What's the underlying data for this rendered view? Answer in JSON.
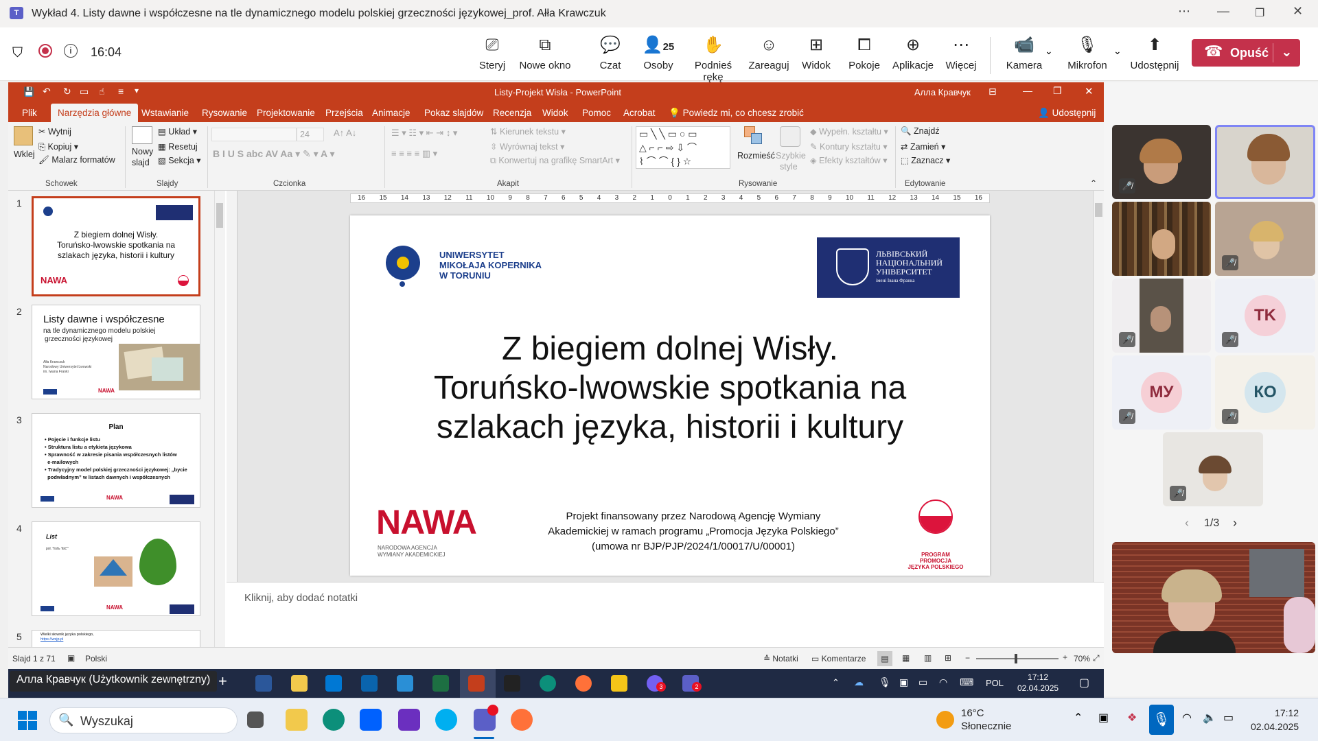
{
  "teams": {
    "window_title": "Wykład 4. Listy dawne i współczesne na tle dynamicznego modelu polskiej grzeczności językowej_prof. Ałła Krawczuk",
    "timer": "16:04",
    "toolbar": {
      "share_screen": "Sterуj",
      "new_window": "Nowe okno",
      "chat": "Czat",
      "people": "Osoby",
      "people_count": "25",
      "raise_hand": "Podnieś rękę",
      "react": "Zareaguj",
      "view": "Widok",
      "rooms": "Pokoje",
      "apps": "Aplikacje",
      "more": "Więcej",
      "camera": "Kamera",
      "mic": "Mikrofon",
      "share": "Udostępnij",
      "leave": "Opuść"
    },
    "participants": {
      "avatars": [
        "TK",
        "МУ",
        "КО"
      ],
      "pager": "1/3"
    },
    "presenter_name": "Алла Кравчук (Użytkownik zewnętrzny)"
  },
  "ppt": {
    "title": "Listy-Projekt Wisła  -  PowerPoint",
    "user": "Алла Кравчук",
    "tabs": [
      "Plik",
      "Narzędzia główne",
      "Wstawianie",
      "Rysowanie",
      "Projektowanie",
      "Przejścia",
      "Animacje",
      "Pokaz slajdów",
      "Recenzja",
      "Widok",
      "Pomoc",
      "Acrobat"
    ],
    "tell_me": "Powiedz mi, co chcesz zrobić",
    "share": "Udostępnij",
    "ribbon": {
      "paste": "Wklej",
      "cut": "Wytnij",
      "copy": "Kopiuj",
      "format_painter": "Malarz formatów",
      "clipboard": "Schowek",
      "new_slide_1": "Nowy",
      "new_slide_2": "slajd",
      "layout": "Układ",
      "reset": "Resetuj",
      "section": "Sekcja",
      "slides": "Slajdy",
      "font_size": "24",
      "font": "Czcionka",
      "text_direction": "Kierunek tekstu",
      "align_text": "Wyrównaj tekst",
      "smartart": "Konwertuj na grafikę SmartArt",
      "paragraph": "Akapit",
      "arrange": "Rozmieść",
      "quick_styles_1": "Szybkie",
      "quick_styles_2": "style",
      "fill": "Wypełn. kształtu",
      "outline": "Kontury kształtu",
      "effects": "Efekty kształtów",
      "drawing": "Rysowanie",
      "find": "Znajdź",
      "replace": "Zamień",
      "select": "Zaznacz",
      "editing": "Edytowanie"
    },
    "thumbs": [
      {
        "num": "1",
        "l1": "Z biegiem dolnej Wisły.",
        "l2": "Toruńsko-lwowskie spotkania na",
        "l3": "szlakach języka, historii i kultury"
      },
      {
        "num": "2",
        "title": "Listy dawne i współczesne",
        "sub1": "na tle dynamicznego modelu polskiej",
        "sub2": "grzeczności językowej",
        "a1": "Ałła Krawczuk",
        "a2": "Narodowy Uniwersytet Lwowski",
        "a3": "im. Iwana Franki"
      },
      {
        "num": "3",
        "title": "Plan",
        "items": [
          "Pojęcie i funkcje listu",
          "Struktura listu a etykieta językowa",
          "Sprawność w zakresie pisania współczesnych listów",
          "e-mailowych",
          "Tradycyjny model polskiej grzeczności językowej: „bycie",
          "podwładnym” w listach dawnych i współczesnych"
        ]
      },
      {
        "num": "4",
        "title": "List",
        "sub": "pol. \"listъ 'liść'\""
      },
      {
        "num": "5",
        "l1": "Wielki słownik języka polskiego,",
        "l2": "https://wsjp.pl"
      }
    ],
    "slide": {
      "umk_1": "UNIWERSYTET",
      "umk_2": "MIKOŁAJA KOPERNIKA",
      "umk_3": "W TORUNIU",
      "lnu_1": "ЛЬВІВСЬКИЙ",
      "lnu_2": "НАЦІОНАЛЬНИЙ",
      "lnu_3": "УНІВЕРСИТЕТ",
      "lnu_4": "імені Івана Франка",
      "title_1": "Z biegiem dolnej Wisły.",
      "title_2": "Toruńsko-lwowskie spotkania na",
      "title_3": "szlakach języka, historii i kultury",
      "nawa": "NAWA",
      "nawa_sub_1": "NARODOWA AGENCJA",
      "nawa_sub_2": "WYMIANY AKADEMICKIEJ",
      "funding_1": "Projekt finansowany przez Narodową Agencję Wymiany",
      "funding_2": "Akademickiej w ramach programu „Promocja Języka Polskiego”",
      "funding_3": "(umowa nr BJP/PJP/2024/1/00017/U/00001)",
      "prog_1": "PROGRAM",
      "prog_2": "PROMOCJA",
      "prog_3": "JĘZYKA POLSKIEGO"
    },
    "ruler_ticks": [
      "16",
      "15",
      "14",
      "13",
      "12",
      "11",
      "10",
      "9",
      "8",
      "7",
      "6",
      "5",
      "4",
      "3",
      "2",
      "1",
      "0",
      "1",
      "2",
      "3",
      "4",
      "5",
      "6",
      "7",
      "8",
      "9",
      "10",
      "11",
      "12",
      "13",
      "14",
      "15",
      "16"
    ],
    "notes_placeholder": "Kliknij, aby dodać notatki",
    "status": {
      "slide_of": "Slajd 1 z 71",
      "language": "Polski",
      "notes": "Notatki",
      "comments": "Komentarze",
      "zoom": "70%"
    }
  },
  "inner_taskbar": {
    "lang": "POL",
    "time": "17:12",
    "date": "02.04.2025",
    "badge_viber": "3",
    "badge_teams": "2"
  },
  "windows_taskbar": {
    "search_placeholder": "Wyszukaj",
    "weather_temp": "16°C",
    "weather_desc": "Słonecznie",
    "time": "17:12",
    "date": "02.04.2025"
  }
}
